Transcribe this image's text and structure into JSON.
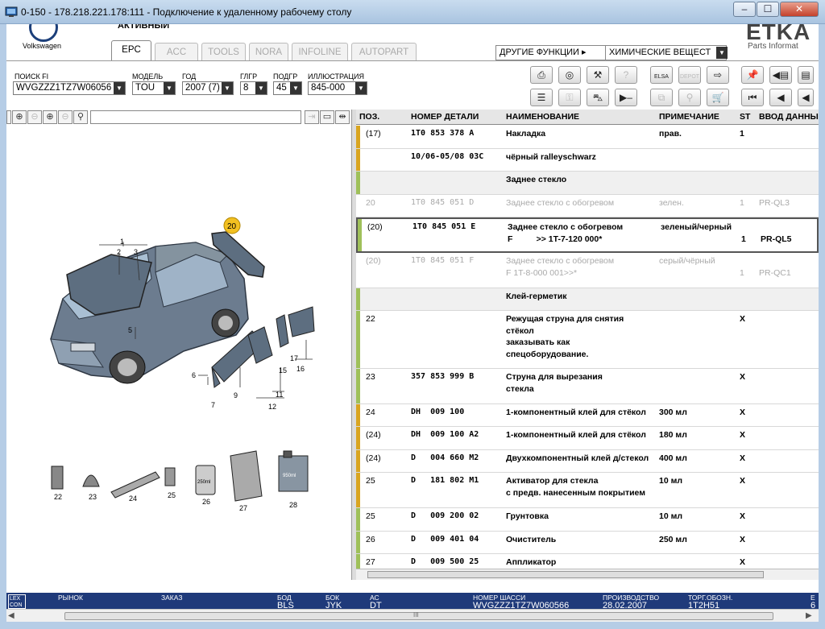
{
  "window": {
    "title": "0-150 - 178.218.221.178:111 - Подключение к удаленному рабочему столу",
    "min_label": "–",
    "max_label": "☐",
    "close_label": "✕"
  },
  "header": {
    "brand": "Volkswagen",
    "top_partial": "АКТИВНЫЙ",
    "app_logo": "ETKA",
    "app_sub": "Parts Informat"
  },
  "tabs": [
    {
      "label": "EPC",
      "active": true
    },
    {
      "label": "ACC",
      "active": false
    },
    {
      "label": "TOOLS",
      "active": false
    },
    {
      "label": "NORA",
      "active": false
    },
    {
      "label": "INFOLINE",
      "active": false
    },
    {
      "label": "AUTOPART",
      "active": false
    }
  ],
  "functions": {
    "label": "ДРУГИЕ ФУНКЦИИ",
    "arrow": "▸",
    "selected": "ХИМИЧЕСКИЕ ВЕЩЕСТ"
  },
  "filters": {
    "search_label": "ПОИСК FI",
    "search_value": "WVGZZZ1TZ7W06056",
    "model_label": "МОДЕЛЬ",
    "model_value": "TOU",
    "year_label": "ГОД",
    "year_value": "2007 (7)",
    "group_label": "ГЛГР",
    "group_value": "8",
    "subgroup_label": "ПОДГР",
    "subgroup_value": "45",
    "illus_label": "ИЛЛЮСТРАЦИЯ",
    "illus_value": "845-000"
  },
  "toolbar_buttons": {
    "elsa": "ELSA",
    "depot": "DEPOT"
  },
  "illustration": {
    "callouts": [
      "1",
      "2",
      "3",
      "5",
      "6",
      "7",
      "9",
      "11",
      "12",
      "15",
      "16",
      "17",
      "20",
      "22",
      "23",
      "24",
      "25",
      "26",
      "27",
      "28"
    ],
    "highlighted": "20",
    "jar_label": "250ml",
    "bottle_label": "950ml"
  },
  "table": {
    "headers": {
      "pos": "ПОЗ.",
      "number": "НОМЕР ДЕТАЛИ",
      "name": "НАИМЕНОВАНИЕ",
      "note": "ПРИМЕЧАНИЕ",
      "st": "ST",
      "input": "ВВОД ДАННЫ"
    },
    "rows": [
      {
        "pos": "(17)",
        "number": "1T0 853 378 A",
        "name": "Накладка",
        "note": "прав.",
        "st": "1",
        "input": "",
        "bar": "#d9a520",
        "style": "normal"
      },
      {
        "pos": "",
        "number": "10/06-05/08 03C",
        "name": "чёрный ralleyschwarz",
        "note": "",
        "st": "",
        "input": "",
        "bar": "#d9a520",
        "style": "normal"
      },
      {
        "pos": "",
        "number": "",
        "name": "Заднее стекло",
        "note": "",
        "st": "",
        "input": "",
        "bar": "#9fc05a",
        "style": "grey"
      },
      {
        "pos": "20",
        "number": "1T0 845 051 D",
        "name": "Заднее стекло с обогревом",
        "note": "зелен.",
        "st": "1",
        "input": "PR-QL3",
        "bar": "",
        "style": "dim"
      },
      {
        "pos": "(20)",
        "number": "1T0 845 051 E",
        "name": "Заднее стекло с обогревом\nF          >> 1T-7-120 000*",
        "note": "зеленый/черный",
        "st": "\n1",
        "input": "\nPR-QL5",
        "bar": "#9fc05a",
        "style": "sel"
      },
      {
        "pos": "(20)",
        "number": "1T0 845 051 F",
        "name": "Заднее стекло с обогревом\nF 1T-8-000 001>>*",
        "note": "серый/чёрный",
        "st": "\n1",
        "input": "\nPR-QC1",
        "bar": "",
        "style": "dim"
      },
      {
        "pos": "",
        "number": "",
        "name": "Клей-герметик",
        "note": "",
        "st": "",
        "input": "",
        "bar": "#9fc05a",
        "style": "grey"
      },
      {
        "pos": "22",
        "number": "",
        "name": "Режущая струна для снятия\nстёкол\nзаказывать как\nспецоборудование.",
        "note": "",
        "st": "X",
        "input": "",
        "bar": "#9fc05a",
        "style": "normal"
      },
      {
        "pos": "23",
        "number": "357 853 999 B",
        "name": "Струна для вырезания\nстекла",
        "note": "",
        "st": "X",
        "input": "",
        "bar": "#9fc05a",
        "style": "normal"
      },
      {
        "pos": "24",
        "number": "DH  009 100",
        "name": "1-компонентный клей для стёкол",
        "note": "300 мл",
        "st": "X",
        "input": "",
        "bar": "#d9a520",
        "style": "normal"
      },
      {
        "pos": "(24)",
        "number": "DH  009 100 A2",
        "name": "1-компонентный клей для стёкол",
        "note": "180 мл",
        "st": "X",
        "input": "",
        "bar": "#d9a520",
        "style": "normal"
      },
      {
        "pos": "(24)",
        "number": "D   004 660 M2",
        "name": "Двухкомпонентный клей д/стекол",
        "note": "400 мл",
        "st": "X",
        "input": "",
        "bar": "#d9a520",
        "style": "normal"
      },
      {
        "pos": "25",
        "number": "D   181 802 M1",
        "name": "Активатор для стекла\nс предв. нанесенным покрытием",
        "note": "10 мл",
        "st": "X",
        "input": "",
        "bar": "#d9a520",
        "style": "normal"
      },
      {
        "pos": "25",
        "number": "D   009 200 02",
        "name": "Грунтовка",
        "note": "10 мл",
        "st": "X",
        "input": "",
        "bar": "#9fc05a",
        "style": "normal"
      },
      {
        "pos": "26",
        "number": "D   009 401 04",
        "name": "Очиститель",
        "note": "250 мл",
        "st": "X",
        "input": "",
        "bar": "#9fc05a",
        "style": "normal"
      },
      {
        "pos": "27",
        "number": "D   009 500 25",
        "name": "Аппликатор",
        "note": "",
        "st": "X",
        "input": "",
        "bar": "#9fc05a",
        "style": "normal"
      }
    ]
  },
  "status": {
    "logo_top": "LEX",
    "logo_bot": "CON",
    "market_label": "РЫНОК",
    "order_label": "ЗАКАЗ",
    "bod_label": "БОД",
    "bod_value": "BLS",
    "bok_label": "БОК",
    "bok_value": "JYK",
    "ac_label": "АС",
    "ac_value": "DT",
    "chassis_label": "НОМЕР ШАССИ",
    "chassis_value": "WVGZZZ1TZ7W060566",
    "prod_label": "ПРОИЗВОДСТВО",
    "prod_value": "28.02.2007",
    "trade_label": "ТОРГ.ОБОЗН.",
    "trade_value": "1T2H51",
    "edge_label": "Е",
    "edge_value": "6"
  },
  "scroll": {
    "grip": "III"
  },
  "colors": {
    "status_bg": "#1f3a7a",
    "bar_yellow": "#d9a520",
    "bar_green": "#9fc05a",
    "callout_highlight": "#f2c021"
  }
}
